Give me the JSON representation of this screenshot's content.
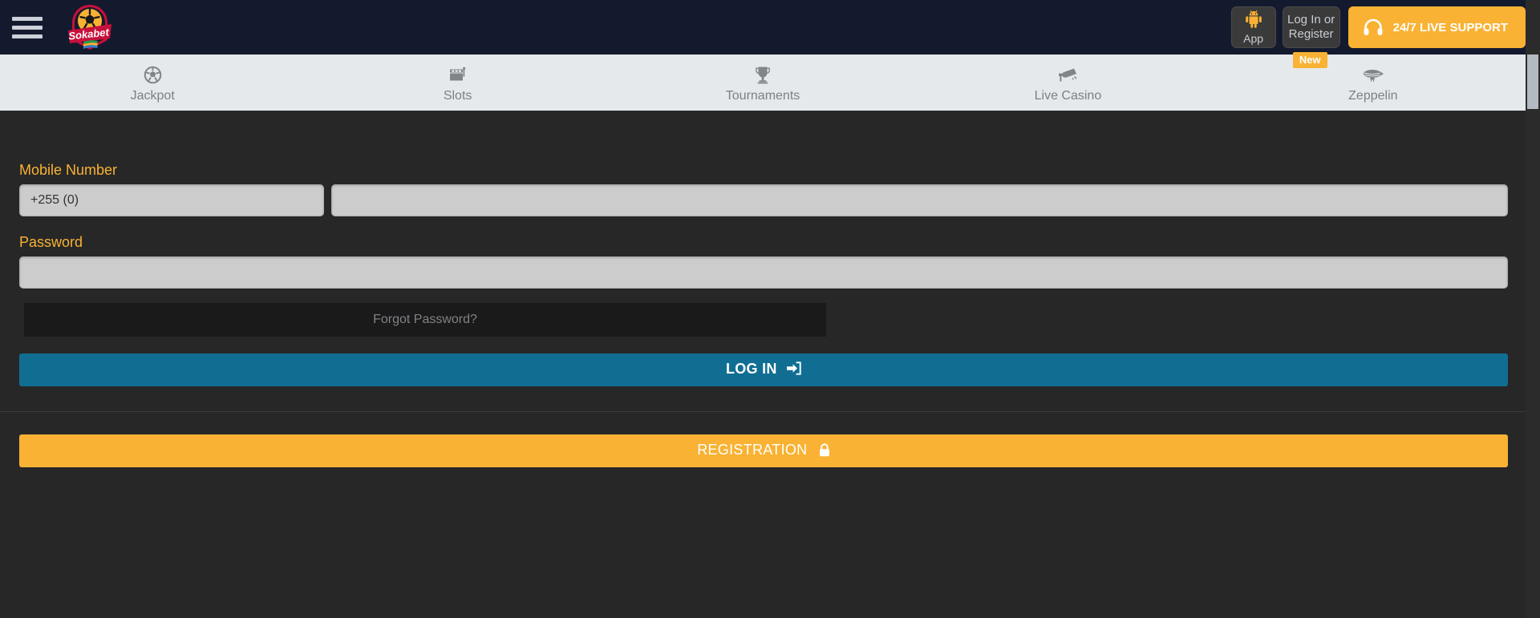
{
  "brand": {
    "name": "Sokabet",
    "accent_yellow": "#f9b233",
    "header_bg": "#141a2e",
    "nav_bg": "#e5e9ec",
    "page_bg": "#272727",
    "login_blue": "#116e93"
  },
  "topbar": {
    "menu_icon": "hamburger-menu-icon",
    "logo_text": "Sokabet",
    "app_button": {
      "icon": "android-icon",
      "label": "App"
    },
    "login_button": {
      "line1": "Log In or",
      "line2": "Register"
    },
    "support_button": {
      "icon": "headset-icon",
      "label": "24/7 LIVE SUPPORT"
    }
  },
  "nav": {
    "items": [
      {
        "label": "Jackpot",
        "icon": "soccer-ball-icon",
        "badge": ""
      },
      {
        "label": "Slots",
        "icon": "slot-machine-icon",
        "badge": ""
      },
      {
        "label": "Tournaments",
        "icon": "trophy-icon",
        "badge": ""
      },
      {
        "label": "Live Casino",
        "icon": "video-camera-icon",
        "badge": ""
      },
      {
        "label": "Zeppelin",
        "icon": "zeppelin-icon",
        "badge": "New"
      }
    ]
  },
  "form": {
    "mobile_label": "Mobile Number",
    "country_prefix_value": "+255 (0)",
    "country_prefix_placeholder": "+255 (0)",
    "phone_value": "",
    "phone_placeholder": "",
    "password_label": "Password",
    "password_value": "",
    "password_placeholder": "",
    "forgot_password_label": "Forgot Password?",
    "login_label": "LOG IN",
    "login_icon": "sign-in-arrow-icon",
    "registration_label": "REGISTRATION",
    "registration_icon": "lock-icon"
  }
}
